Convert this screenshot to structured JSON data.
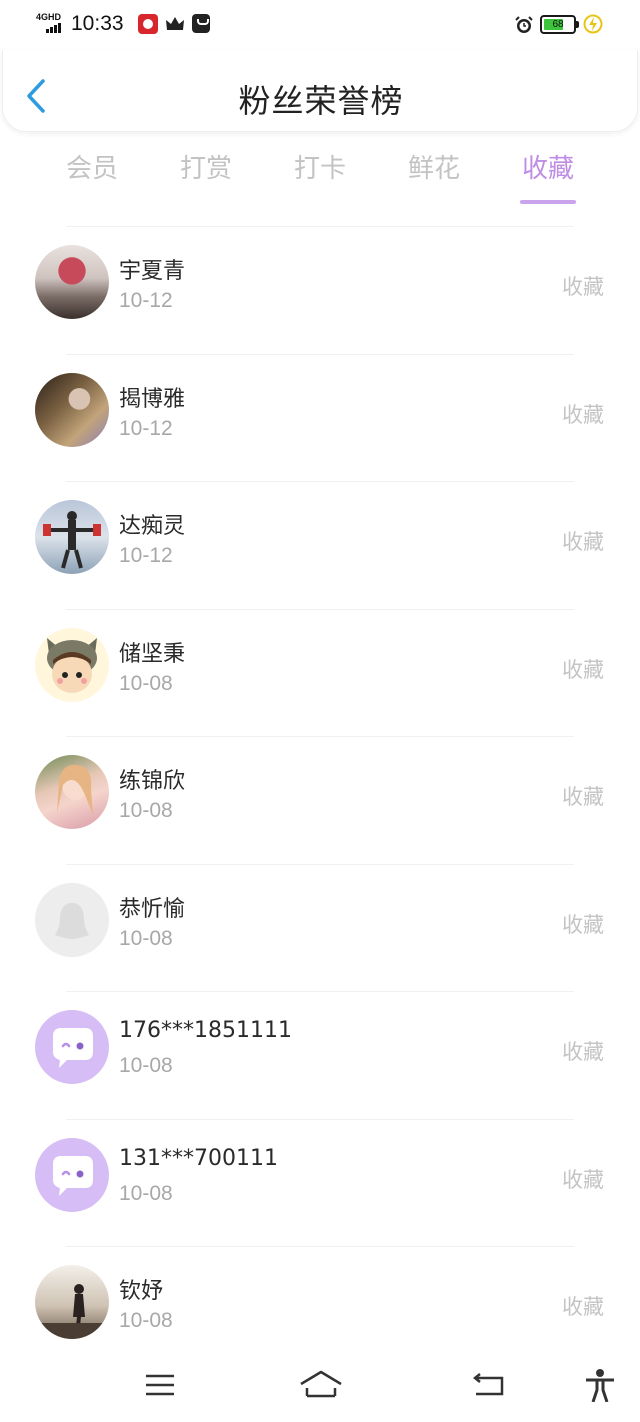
{
  "status_bar": {
    "network": "4GHD",
    "time": "10:33",
    "battery_level": "68",
    "battery_fraction": 0.68,
    "icons": [
      "signal-icon",
      "app-red-icon",
      "crown-icon",
      "bag-icon",
      "alarm-icon",
      "battery-icon",
      "charging-icon"
    ]
  },
  "header": {
    "back_icon": "chevron-left-icon",
    "title": "粉丝荣誉榜"
  },
  "tabs": [
    {
      "label": "会员",
      "active": false
    },
    {
      "label": "打赏",
      "active": false
    },
    {
      "label": "打卡",
      "active": false
    },
    {
      "label": "鲜花",
      "active": false
    },
    {
      "label": "收藏",
      "active": true
    }
  ],
  "colors": {
    "accent": "#bf8de6",
    "inactive_tab": "#c3c3c3",
    "secondary_text": "#a8a8a8",
    "action_text": "#c4c4c4"
  },
  "fans": [
    {
      "name": "宇夏青",
      "date": "10-12",
      "action": "收藏"
    },
    {
      "name": "揭博雅",
      "date": "10-12",
      "action": "收藏"
    },
    {
      "name": "达痴灵",
      "date": "10-12",
      "action": "收藏"
    },
    {
      "name": "储坚秉",
      "date": "10-08",
      "action": "收藏"
    },
    {
      "name": "练锦欣",
      "date": "10-08",
      "action": "收藏"
    },
    {
      "name": "恭忻愉",
      "date": "10-08",
      "action": "收藏"
    },
    {
      "name": "176***1851111",
      "date": "10-08",
      "action": "收藏"
    },
    {
      "name": "131***700111",
      "date": "10-08",
      "action": "收藏"
    },
    {
      "name": "钦妤",
      "date": "10-08",
      "action": "收藏"
    }
  ],
  "bottom_nav": [
    "menu-icon",
    "home-icon",
    "back-icon",
    "accessibility-icon"
  ]
}
